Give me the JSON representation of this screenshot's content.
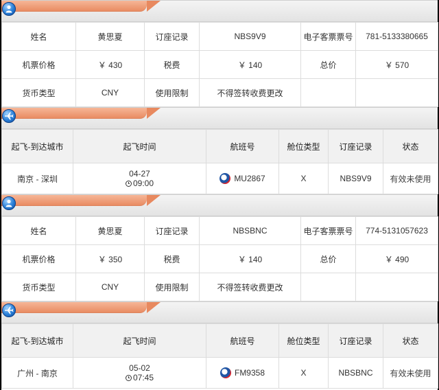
{
  "colors": {
    "tab_orange": "#e8895f",
    "header_gray": "#e8e8e8",
    "icon_blue": "#2a7fd7"
  },
  "labels": {
    "name": "姓名",
    "booking_record": "订座记录",
    "eticket_no": "电子客票票号",
    "ticket_price": "机票价格",
    "tax": "税费",
    "total": "总价",
    "currency_type": "货币类型",
    "restriction": "使用限制",
    "route": "起飞-到达城市",
    "departure_time": "起飞时间",
    "flight_no": "航班号",
    "cabin_class": "舱位类型",
    "status": "状态"
  },
  "tickets": [
    {
      "passenger": {
        "name": "黄思夏",
        "booking_record": "NBS9V9",
        "eticket_no": "781-5133380665",
        "ticket_price": "￥ 430",
        "tax": "￥ 140",
        "total": "￥ 570",
        "currency": "CNY",
        "restriction": "不得签转收费更改"
      },
      "flight": {
        "route": "南京 - 深圳",
        "date": "04-27",
        "time": "09:00",
        "flight_no": "MU2867",
        "cabin": "X",
        "booking_record": "NBS9V9",
        "status": "有效未使用"
      }
    },
    {
      "passenger": {
        "name": "黄思夏",
        "booking_record": "NBSBNC",
        "eticket_no": "774-5131057623",
        "ticket_price": "￥ 350",
        "tax": "￥ 140",
        "total": "￥ 490",
        "currency": "CNY",
        "restriction": "不得签转收费更改"
      },
      "flight": {
        "route": "广州 - 南京",
        "date": "05-02",
        "time": "07:45",
        "flight_no": "FM9358",
        "cabin": "X",
        "booking_record": "NBSBNC",
        "status": "有效未使用"
      }
    }
  ]
}
